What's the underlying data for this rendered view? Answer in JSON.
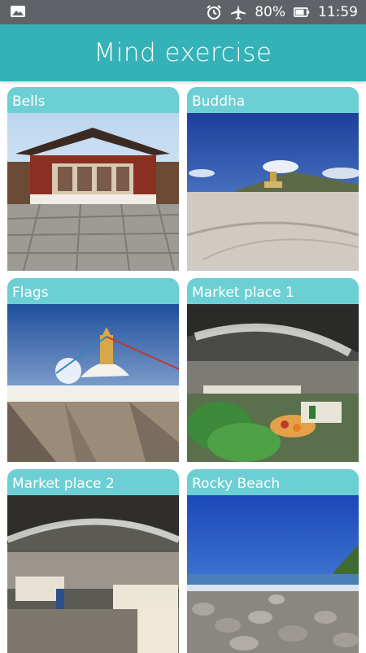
{
  "status_bar": {
    "left_icon": "image-icon",
    "battery_percent_text": "80%",
    "time": "11:59",
    "icons": [
      "alarm-icon",
      "airplane-icon",
      "battery-icon"
    ]
  },
  "app_bar": {
    "title": "Mind exercise",
    "color": "#34b2b8"
  },
  "cards": [
    {
      "label": "Bells"
    },
    {
      "label": "Buddha"
    },
    {
      "label": "Flags"
    },
    {
      "label": "Market place 1"
    },
    {
      "label": "Market place 2"
    },
    {
      "label": "Rocky Beach"
    }
  ],
  "colors": {
    "card_header": "#6ccfd3",
    "status_bar": "#5f6368"
  }
}
